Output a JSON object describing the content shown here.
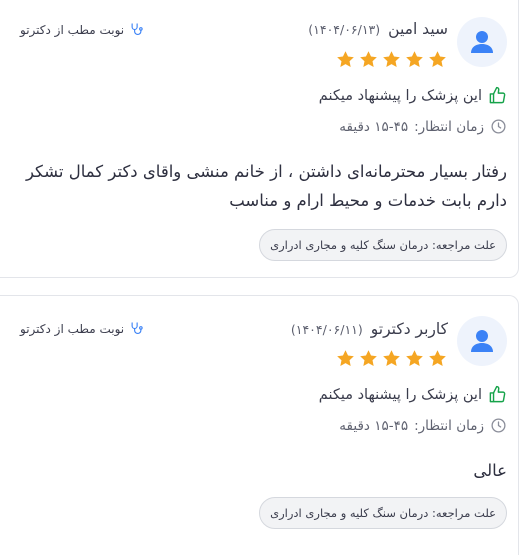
{
  "colors": {
    "star": "#f5a623",
    "accent_green": "#16a34a",
    "accent_blue": "#3b82f6",
    "avatar_bg": "#eef3fc"
  },
  "reviews": [
    {
      "name": "سید امین",
      "date": "(۱۴۰۴/۰۶/۱۳)",
      "rating": 5,
      "badge": "نوبت مطب از دکترتو",
      "recommend": "این پزشک را پیشنهاد میکنم",
      "wait_label": "زمان انتظار:",
      "wait_value": "۱۵-۴۵ دقیقه",
      "comment": "رفتار بسیار محترمانه‌ای داشتن ، از خانم منشی واقای دکتر کمال تشکر دارم بابت خدمات و محیط ارام و مناسب",
      "reason_label": "علت مراجعه:",
      "reason_value": "درمان سنگ کلیه و مجاری ادراری"
    },
    {
      "name": "کاربر دکترتو",
      "date": "(۱۴۰۴/۰۶/۱۱)",
      "rating": 5,
      "badge": "نوبت مطب از دکترتو",
      "recommend": "این پزشک را پیشنهاد میکنم",
      "wait_label": "زمان انتظار:",
      "wait_value": "۱۵-۴۵ دقیقه",
      "comment": "عالی",
      "reason_label": "علت مراجعه:",
      "reason_value": "درمان سنگ کلیه و مجاری ادراری"
    }
  ]
}
